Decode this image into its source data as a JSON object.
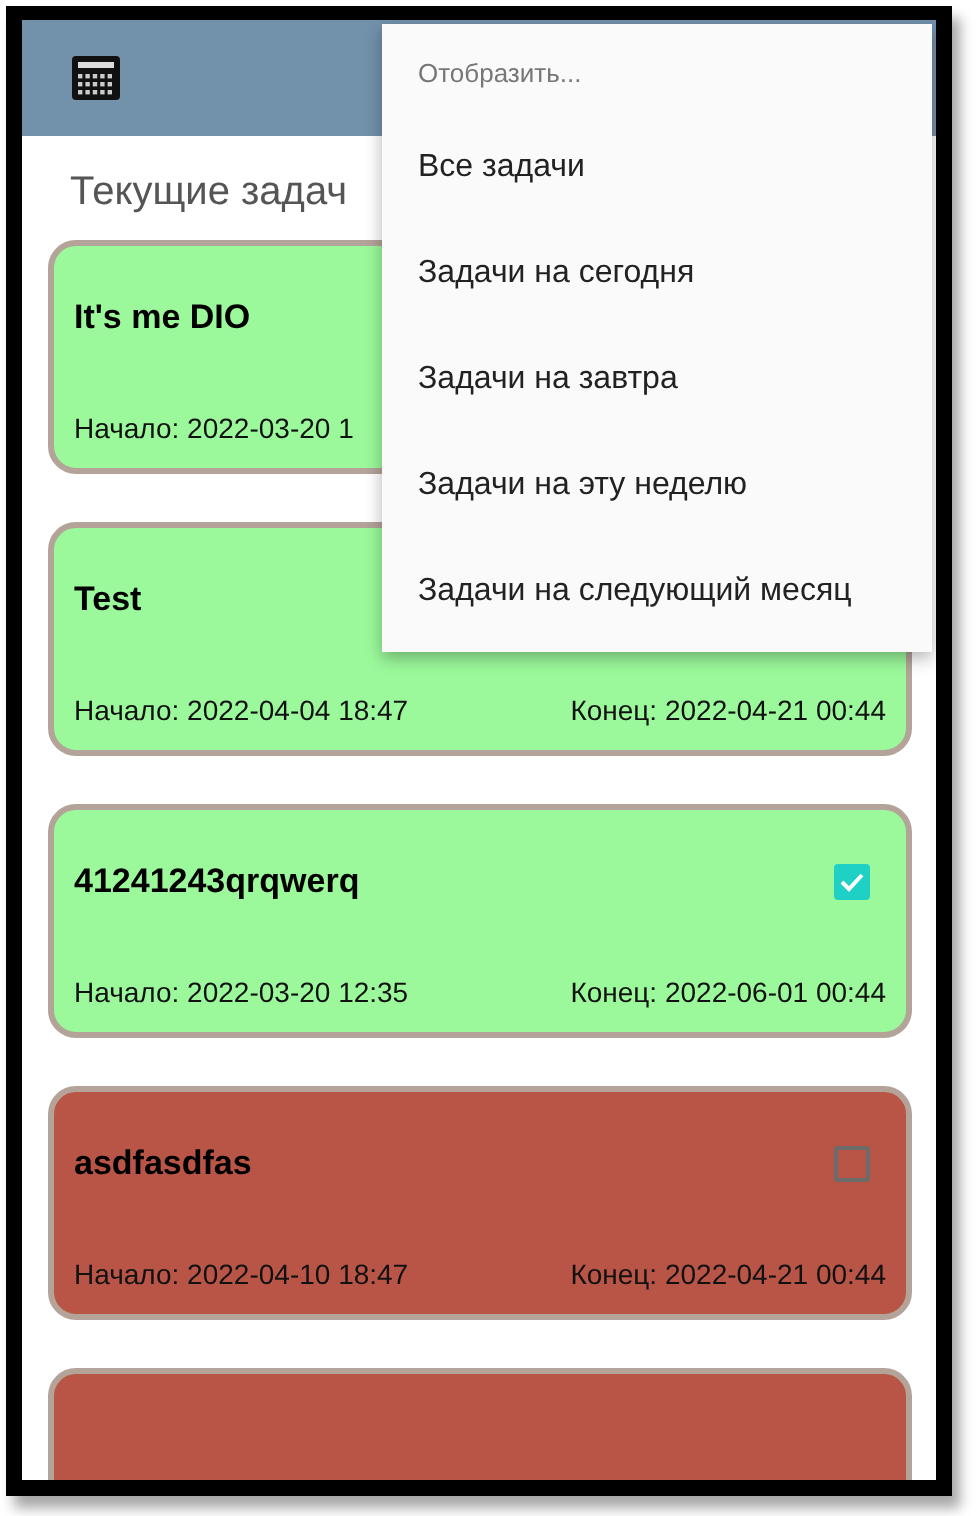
{
  "app_bar": {
    "title": "Текущие задач"
  },
  "menu": {
    "header": "Отобразить...",
    "items": [
      {
        "label": "Все задачи"
      },
      {
        "label": "Задачи на сегодня"
      },
      {
        "label": "Задачи на завтра"
      },
      {
        "label": "Задачи на эту неделю"
      },
      {
        "label": "Задачи на следующий месяц"
      }
    ]
  },
  "tasks": [
    {
      "color": "#9bf99b",
      "title": "It's me DIO",
      "start": "Начало: 2022-03-20 1"
    },
    {
      "color": "#9bf99b",
      "title": "Test",
      "start": "Начало: 2022-04-04 18:47",
      "end": "Конец: 2022-04-21 00:44"
    },
    {
      "color": "#9bf99b",
      "title": "41241243qrqwerq",
      "start": "Начало: 2022-03-20 12:35",
      "end": "Конец: 2022-06-01 00:44",
      "checked": true
    },
    {
      "color": "#b95546",
      "title": "asdfasdfas",
      "start": "Начало: 2022-04-10 18:47",
      "end": "Конец: 2022-04-21 00:44",
      "checked": false
    },
    {
      "color": "#b95546"
    }
  ]
}
